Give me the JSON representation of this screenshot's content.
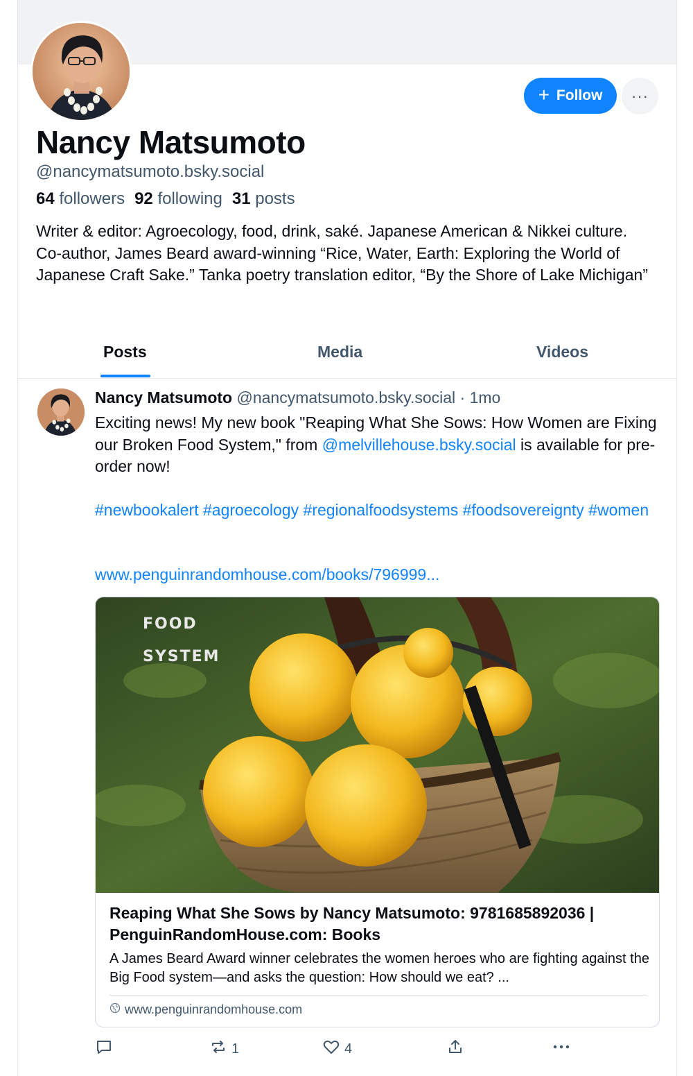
{
  "profile": {
    "display_name": "Nancy Matsumoto",
    "handle": "@nancymatsumoto.bsky.social",
    "followers_count": "64",
    "followers_label": "followers",
    "following_count": "92",
    "following_label": "following",
    "posts_count": "31",
    "posts_label": "posts",
    "bio": "Writer & editor: Agroecology, food, drink, saké. Japanese American & Nikkei culture. Co-author, James Beard award-winning “Rice, Water, Earth: Exploring the World of Japanese Craft Sake.” Tanka poetry translation editor, “By the Shore of Lake Michigan”",
    "follow_label": "Follow",
    "more_label": "···"
  },
  "tabs": [
    {
      "label": "Posts",
      "active": true
    },
    {
      "label": "Media",
      "active": false
    },
    {
      "label": "Videos",
      "active": false
    }
  ],
  "post": {
    "author_name": "Nancy Matsumoto",
    "author_handle": "@nancymatsumoto.bsky.social",
    "time_sep": "·",
    "time": "1mo",
    "text_before": "Exciting news! My new book \"Reaping What She Sows: How Women are Fixing our Broken Food System,\" from ",
    "mention": "@melvillehouse.bsky.social",
    "text_after": " is available for pre-order now!",
    "hashtags": [
      "#newbookalert",
      "#agroecology",
      "#regionalfoodsystems",
      "#foodsovereignty",
      "#women"
    ],
    "url": "www.penguinrandomhouse.com/books/796999...",
    "card": {
      "image_text_1": "FOOD",
      "image_text_2": "SYSTEM",
      "title": "Reaping What She Sows by Nancy Matsumoto: 9781685892036 | PenguinRandomHouse.com: Books",
      "description": "A James Beard Award winner celebrates the women heroes who are fighting against the Big Food system—and asks the question: How should we eat? ...",
      "domain": "www.penguinrandomhouse.com"
    },
    "actions": {
      "reply_count": "",
      "repost_count": "1",
      "like_count": "4"
    }
  },
  "colors": {
    "accent": "#1083fe",
    "secondary_text": "#42576c",
    "banner": "#f1f2f4"
  }
}
